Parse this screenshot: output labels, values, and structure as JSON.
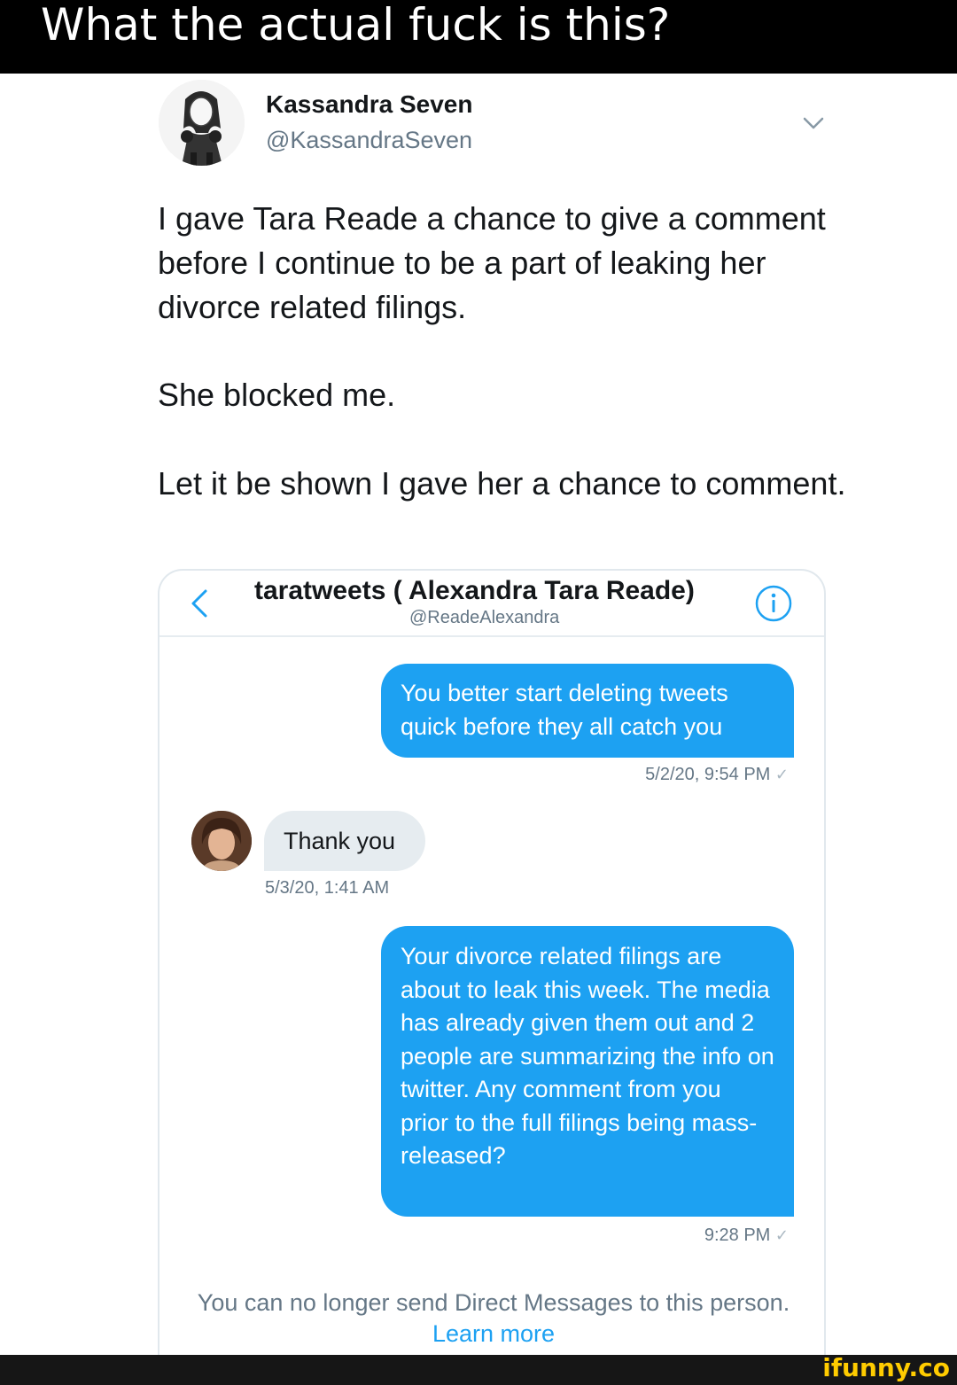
{
  "banner": {
    "title": "What the actual fuck is this?"
  },
  "tweet": {
    "display_name": "Kassandra Seven",
    "handle": "@KassandraSeven",
    "paragraphs": [
      "I gave Tara Reade a chance to give a comment before I continue to be a part of leaking her divorce related filings.",
      "She blocked me.",
      "Let it be shown I gave her a chance to comment."
    ]
  },
  "dm": {
    "contact_name": "taratweets ( Alexandra Tara Reade)",
    "contact_handle": "@ReadeAlexandra",
    "messages": [
      {
        "direction": "sent",
        "text": "You better start deleting tweets quick before they all catch you",
        "timestamp": "5/2/20, 9:54 PM"
      },
      {
        "direction": "received",
        "text": "Thank you",
        "timestamp": "5/3/20, 1:41 AM"
      },
      {
        "direction": "sent",
        "text": "Your divorce related filings are about to leak this week. The media has already given them out and 2 people are summarizing the info on twitter. Any comment from you prior to the full filings being mass-released?",
        "timestamp": "9:28 PM"
      }
    ],
    "blocked_notice": "You can no longer send Direct Messages to this person.",
    "learn_more": "Learn more"
  },
  "watermark": "ifunny.co",
  "colors": {
    "accent": "#1da1f2",
    "incoming_bubble": "#e6ecf0",
    "banner": "#000000",
    "watermark": "#ffcc00"
  },
  "icons": [
    "chevron-down-icon",
    "back-chevron-icon",
    "info-icon",
    "check-icon"
  ]
}
